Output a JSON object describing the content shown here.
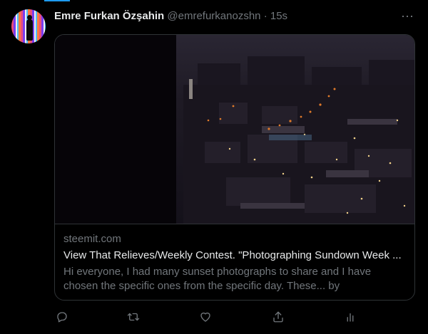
{
  "tweet": {
    "author_name": "Emre Furkan Özşahin",
    "author_handle": "@emrefurkanozshn",
    "separator": "·",
    "timestamp": "15s"
  },
  "link_card": {
    "domain": "steemit.com",
    "title": "View That Relieves/Weekly Contest. \"Photographing Sundown Week ...",
    "description": "Hi everyone, I had many sunset photographs to share and I have chosen the specific ones from the specific day. These... by emrefurkanozshn"
  },
  "icons": {
    "more": "more-horizontal-icon",
    "reply": "reply-icon",
    "retweet": "retweet-icon",
    "like": "like-icon",
    "share": "share-icon",
    "analytics": "analytics-icon"
  },
  "colors": {
    "background": "#000000",
    "text_primary": "#e7e9ea",
    "text_secondary": "#71767b",
    "border": "#2f3336",
    "accent": "#1d9bf0"
  }
}
